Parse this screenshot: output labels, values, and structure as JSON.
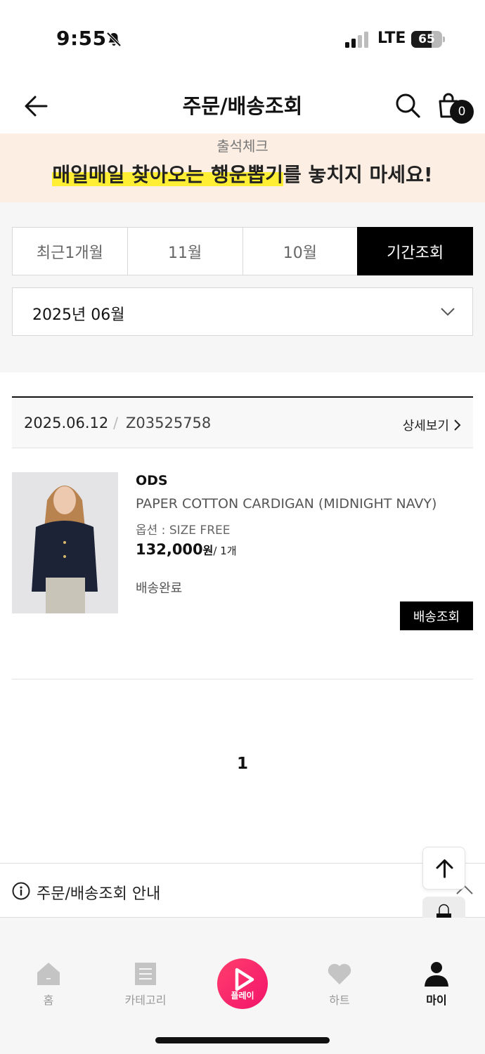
{
  "status_bar": {
    "time": "9:55",
    "network": "LTE",
    "battery": "65",
    "battery_level": 0.65
  },
  "header": {
    "title": "주문/배송조회",
    "cart_count": "0"
  },
  "banner": {
    "subtitle": "출석체크",
    "headline_highlight": "매일매일 찾아오는 행운뽑기",
    "headline_rest": "를 놓치지 마세요!"
  },
  "period_tabs": [
    {
      "label": "최근1개월",
      "active": false
    },
    {
      "label": "11월",
      "active": false
    },
    {
      "label": "10월",
      "active": false
    },
    {
      "label": "기간조회",
      "active": true
    }
  ],
  "month_select": {
    "value": "2025년 06월"
  },
  "order": {
    "date": "2025.06.12",
    "separator": "/",
    "order_number": "Z03525758",
    "detail_link": "상세보기",
    "item": {
      "brand": "ODS",
      "name": "PAPER COTTON CARDIGAN (MIDNIGHT NAVY)",
      "option": "옵션 : SIZE FREE",
      "price": "132,000",
      "currency": "원",
      "quantity": "/ 1개",
      "status": "배송완료",
      "track_button": "배송조회"
    }
  },
  "pagination": {
    "current": "1"
  },
  "info": {
    "label": "주문/배송조회 안내"
  },
  "bottom_nav": {
    "home": "홈",
    "category": "카테고리",
    "play": "플레이",
    "heart": "하트",
    "my": "마이"
  },
  "colors": {
    "accent": "#000000",
    "banner_bg": "#fdeee3",
    "highlight": "#ffee33",
    "play": "#f2146b"
  }
}
